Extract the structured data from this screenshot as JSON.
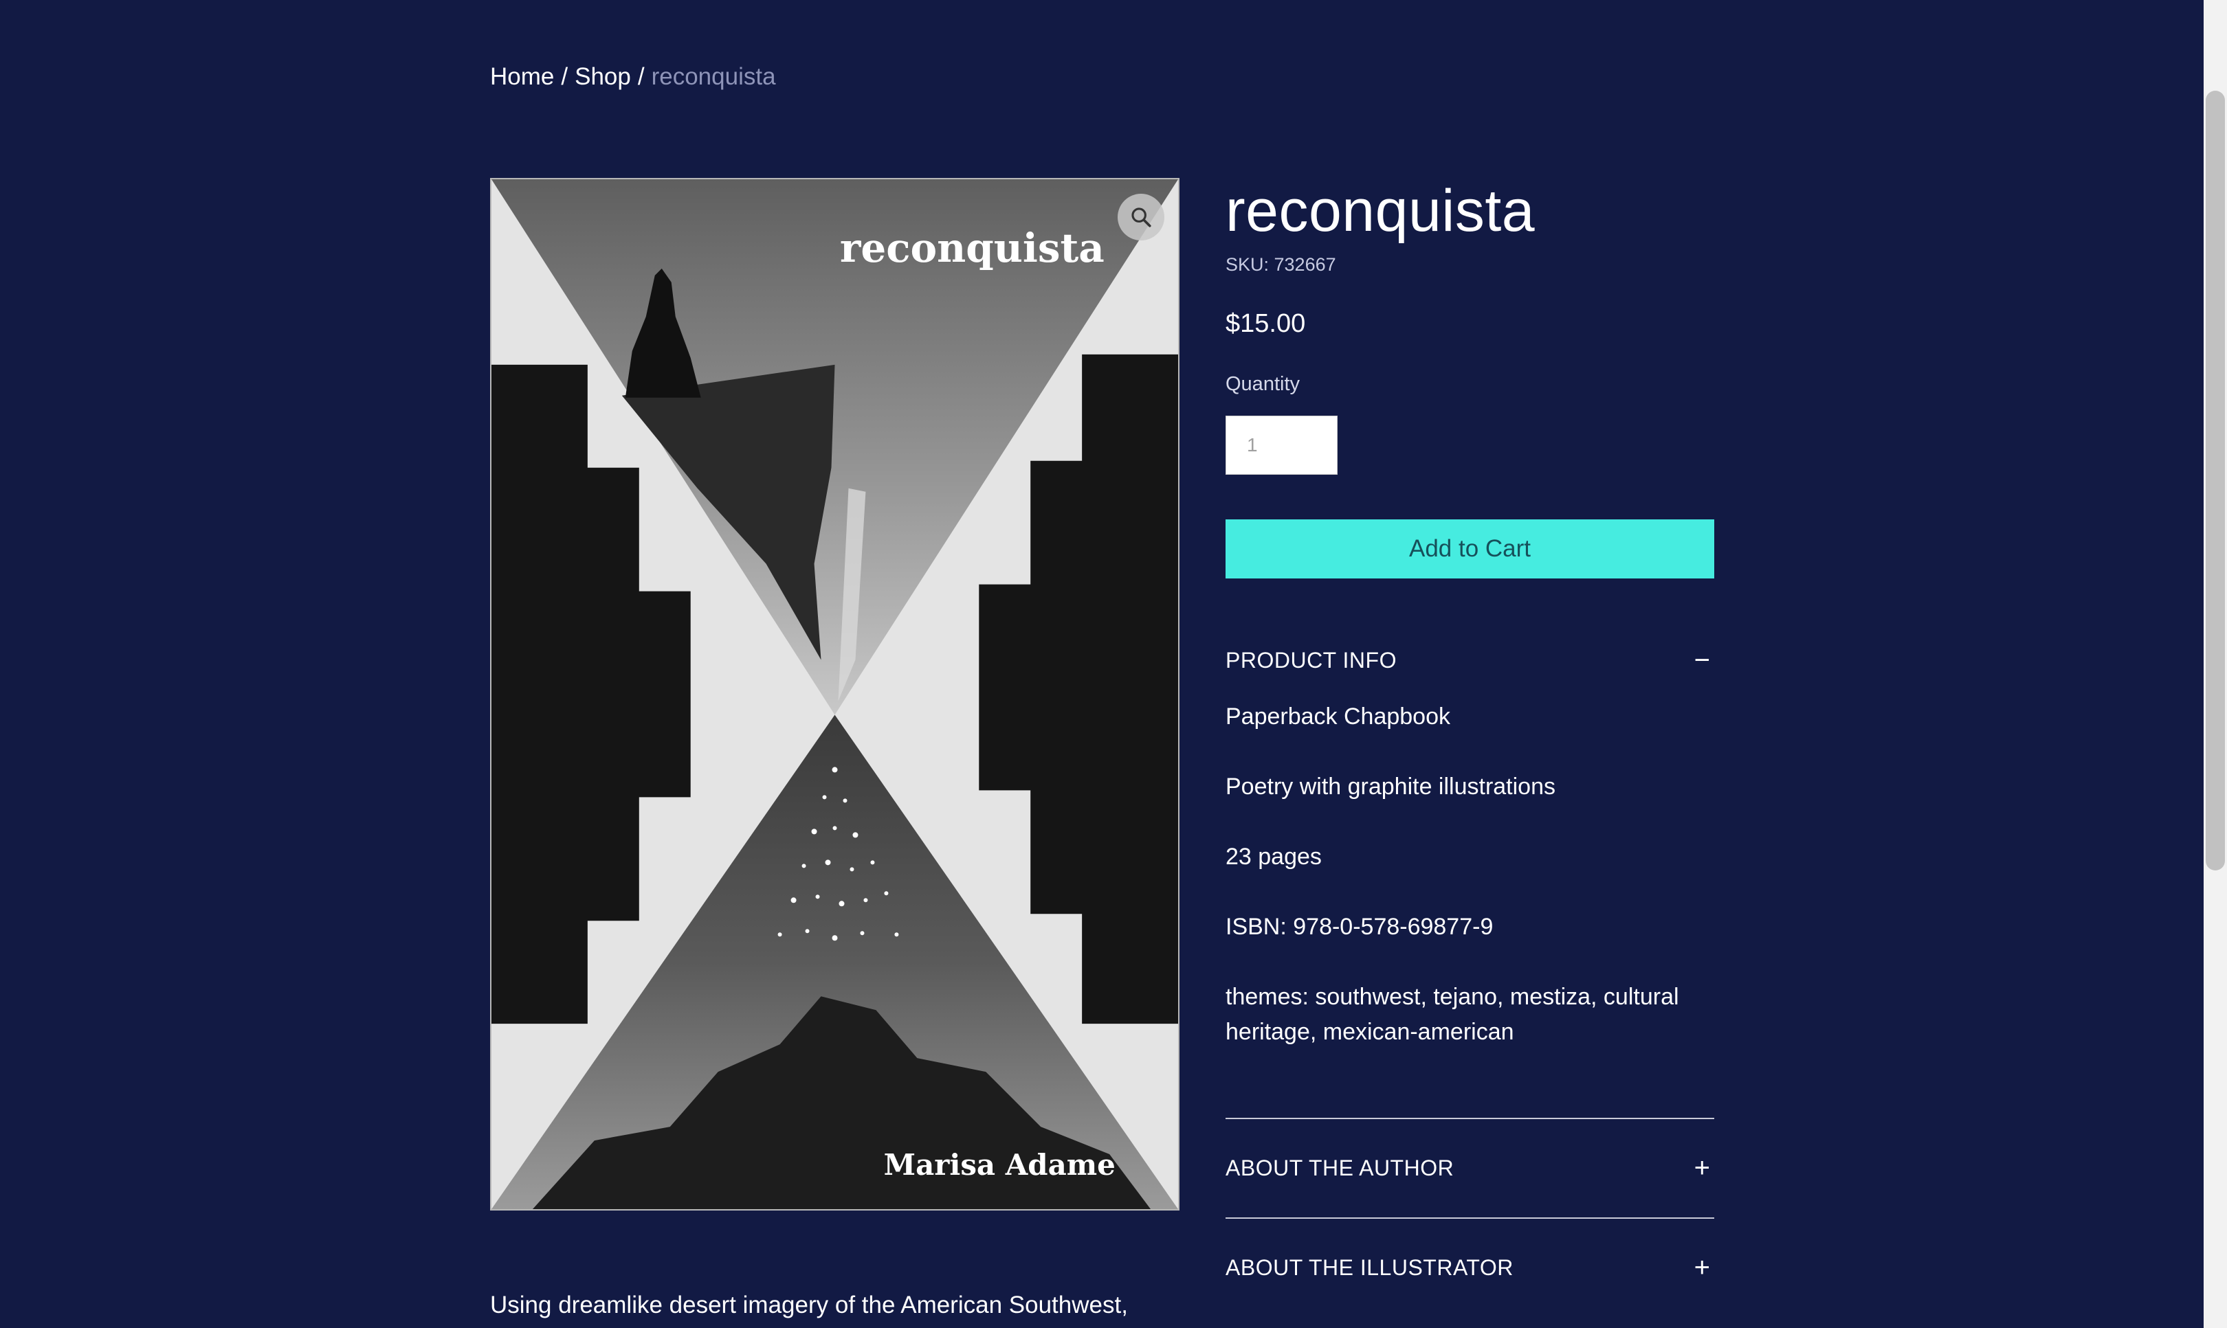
{
  "breadcrumb": {
    "home": "Home",
    "shop": "Shop",
    "current": "reconquista",
    "separator": "/"
  },
  "product": {
    "title": "reconquista",
    "sku": "SKU: 732667",
    "price": "$15.00",
    "quantity_label": "Quantity",
    "quantity_value": "1",
    "add_to_cart": "Add to Cart"
  },
  "cover": {
    "title": "reconquista",
    "author": "Marisa Adame",
    "zoom_icon": "magnifier-icon"
  },
  "accordion": {
    "product_info": {
      "label": "PRODUCT INFO",
      "sign": "−",
      "lines": [
        "Paperback Chapbook",
        "Poetry with graphite illustrations",
        "23 pages",
        "ISBN: 978-0-578-69877-9",
        "themes: southwest, tejano, mestiza, cultural heritage, mexican-american"
      ]
    },
    "about_author": {
      "label": "ABOUT THE AUTHOR",
      "sign": "+"
    },
    "about_illustrator": {
      "label": "ABOUT THE ILLUSTRATOR",
      "sign": "+"
    }
  },
  "description": "Using dreamlike desert imagery of the American Southwest,",
  "colors": {
    "background": "#121a44",
    "accent": "#46ece0",
    "muted_text": "#8e94b8"
  }
}
